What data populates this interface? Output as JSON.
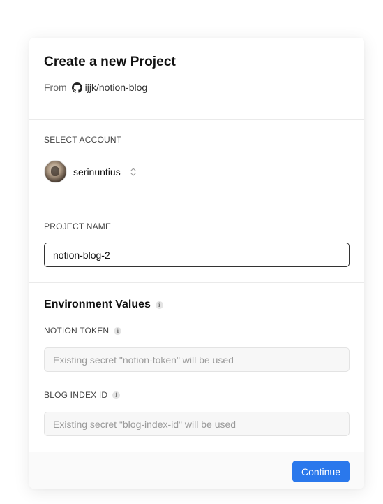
{
  "header": {
    "title": "Create a new Project",
    "from_label": "From",
    "repo": "ijjk/notion-blog",
    "repo_icon": "github-icon"
  },
  "account": {
    "section_label": "SELECT ACCOUNT",
    "username": "serinuntius",
    "avatar_icon": "avatar",
    "switch_icon": "chevron-updown-icon"
  },
  "project": {
    "section_label": "PROJECT NAME",
    "name_value": "notion-blog-2"
  },
  "environment": {
    "title": "Environment Values",
    "fields": [
      {
        "label": "NOTION TOKEN",
        "placeholder": "Existing secret \"notion-token\" will be used"
      },
      {
        "label": "BLOG INDEX ID",
        "placeholder": "Existing secret \"blog-index-id\" will be used"
      }
    ]
  },
  "footer": {
    "continue_label": "Continue"
  },
  "colors": {
    "accent": "#2a78ec",
    "border": "#eaeaea",
    "input_bg": "#f7f7f7"
  }
}
